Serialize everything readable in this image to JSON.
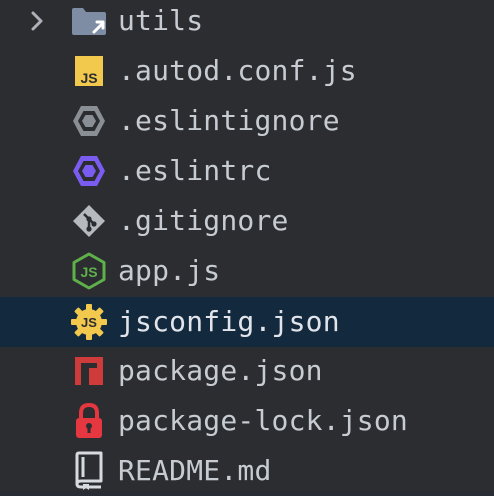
{
  "tree": {
    "items": [
      {
        "label": "utils",
        "icon": "folder-icon",
        "type": "folder",
        "expanded": false
      },
      {
        "label": ".autod.conf.js",
        "icon": "javascript-file-icon",
        "type": "file"
      },
      {
        "label": ".eslintignore",
        "icon": "eslint-ignore-icon",
        "type": "file"
      },
      {
        "label": ".eslintrc",
        "icon": "eslint-config-icon",
        "type": "file"
      },
      {
        "label": ".gitignore",
        "icon": "git-icon",
        "type": "file"
      },
      {
        "label": "app.js",
        "icon": "nodejs-icon",
        "type": "file"
      },
      {
        "label": "jsconfig.json",
        "icon": "js-config-icon",
        "type": "file",
        "selected": true
      },
      {
        "label": "package.json",
        "icon": "npm-icon",
        "type": "file"
      },
      {
        "label": "package-lock.json",
        "icon": "lock-icon",
        "type": "file"
      },
      {
        "label": "README.md",
        "icon": "readme-book-icon",
        "type": "file"
      }
    ]
  },
  "colors": {
    "background": "#2B2D30",
    "selected_row": "#132A3E",
    "text": "#C7CBD2",
    "js_yellow": "#F2C94C",
    "eslint_gray": "#8A8E95",
    "eslint_purple": "#7B5CF0",
    "git_gray": "#B6B9BE",
    "node_green": "#5FB04A",
    "npm_red": "#CF3B3B",
    "lock_red": "#E5373F"
  }
}
